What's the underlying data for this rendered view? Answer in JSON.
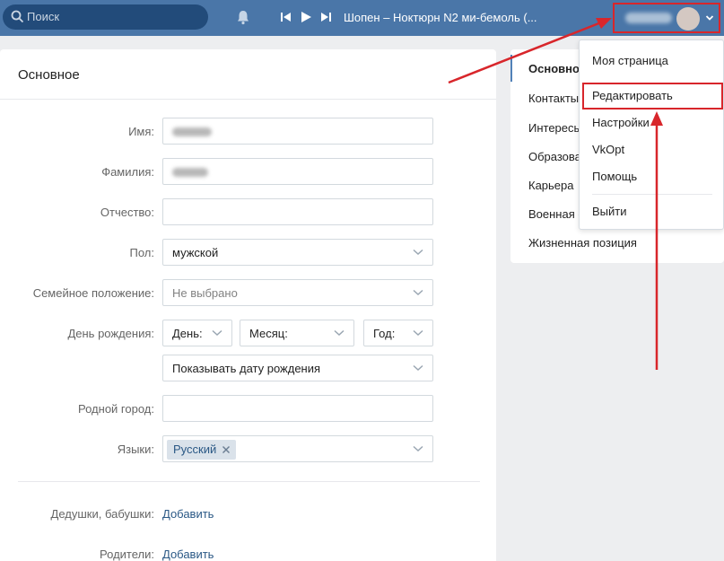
{
  "header": {
    "search_placeholder": "Поиск",
    "track_title": "Шопен – Ноктюрн N2 ми-бемоль (...",
    "colors": {
      "bar": "#4a76a8",
      "search": "#224b7a",
      "highlight": "#d8262b"
    }
  },
  "card": {
    "title": "Основное",
    "fields": {
      "first_name_label": "Имя:",
      "last_name_label": "Фамилия:",
      "patronymic_label": "Отчество:",
      "gender_label": "Пол:",
      "gender_value": "мужской",
      "marital_label": "Семейное положение:",
      "marital_value": "Не выбрано",
      "birthday_label": "День рождения:",
      "day_value": "День:",
      "month_value": "Месяц:",
      "year_value": "Год:",
      "birth_visibility": "Показывать дату рождения",
      "hometown_label": "Родной город:",
      "languages_label": "Языки:",
      "language_tag": "Русский"
    },
    "relatives": {
      "grandparents_label": "Дедушки, бабушки:",
      "parents_label": "Родители:",
      "add_link": "Добавить"
    }
  },
  "right_menu": {
    "items": [
      "Основное",
      "Контакты",
      "Интересы",
      "Образование",
      "Карьера",
      "Военная служба",
      "Жизненная позиция"
    ]
  },
  "dropdown": {
    "items": [
      "Моя страница",
      "Редактировать",
      "Настройки",
      "VkOpt",
      "Помощь"
    ],
    "logout": "Выйти"
  }
}
